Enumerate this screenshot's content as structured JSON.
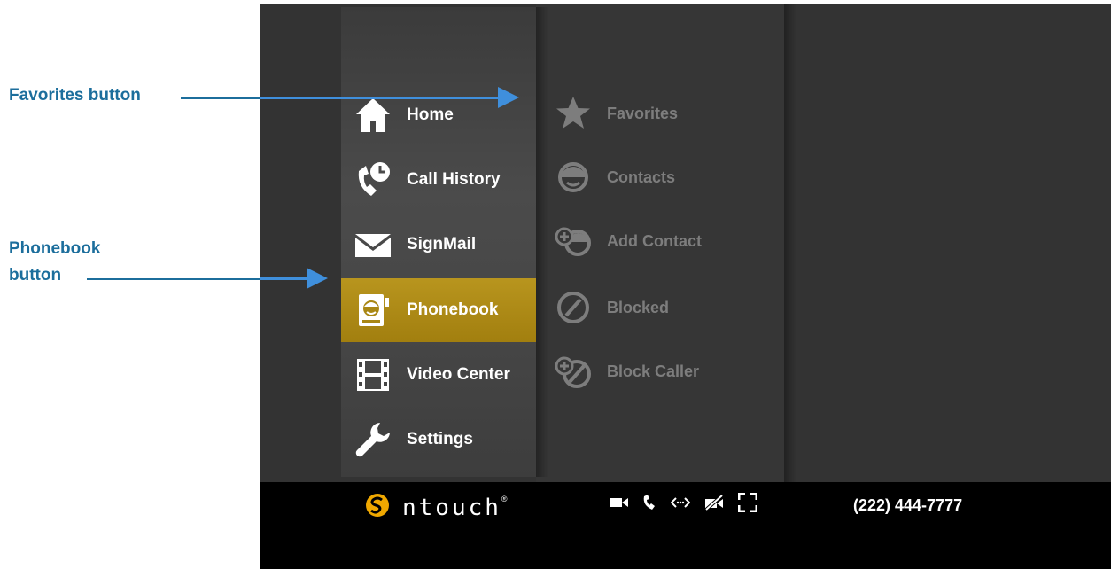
{
  "annotations": {
    "favorites_label": "Favorites button",
    "phonebook_label_line1": "Phonebook",
    "phonebook_label_line2": "button"
  },
  "main_menu": [
    {
      "label": "Home",
      "icon": "home-icon"
    },
    {
      "label": "Call History",
      "icon": "call-history-icon"
    },
    {
      "label": "SignMail",
      "icon": "envelope-icon"
    },
    {
      "label": "Phonebook",
      "icon": "phonebook-icon",
      "selected": true
    },
    {
      "label": "Video Center",
      "icon": "film-icon"
    },
    {
      "label": "Settings",
      "icon": "wrench-icon"
    }
  ],
  "phonebook_menu": [
    {
      "label": "Favorites",
      "icon": "star-icon"
    },
    {
      "label": "Contacts",
      "icon": "contact-icon"
    },
    {
      "label": "Add Contact",
      "icon": "add-contact-icon"
    },
    {
      "label": "Blocked",
      "icon": "blocked-icon"
    },
    {
      "label": "Block Caller",
      "icon": "block-caller-icon"
    }
  ],
  "status_bar": {
    "brand": "ntouch",
    "brand_mark": "®",
    "phone_number": "(222) 444-7777",
    "icons": [
      "video-camera-icon",
      "phone-icon",
      "network-icon",
      "video-privacy-icon",
      "fullscreen-icon"
    ]
  },
  "colors": {
    "selected": "#b08d18",
    "annotation": "#1c6e9c",
    "arrow": "#3f8fdc",
    "screen_bg": "#333333"
  }
}
